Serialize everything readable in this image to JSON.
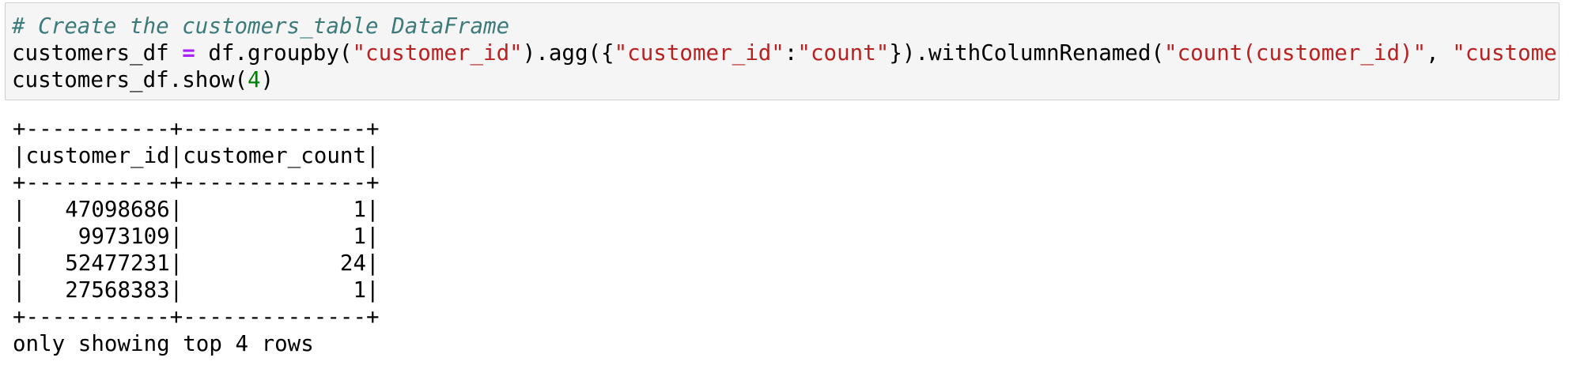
{
  "code_cell": {
    "comment": "# Create the customers_table DataFrame",
    "line2": {
      "var": "customers_df ",
      "op": "=",
      "p1": " df.groupby(",
      "s1": "\"customer_id\"",
      "p2": ").agg({",
      "s2": "\"customer_id\"",
      "p3": ":",
      "s3": "\"count\"",
      "p4": "}).withColumnRenamed(",
      "s4": "\"count(customer_id)\"",
      "p5": ", ",
      "s5": "\"customer_count\")"
    },
    "line3": {
      "p1": "customers_df.show(",
      "num": "4",
      "p2": ")"
    }
  },
  "output": {
    "border_line": "+-----------+--------------+",
    "header_line": "|customer_id|customer_count|",
    "rows": [
      "|   47098686|             1|",
      "|    9973109|             1|",
      "|   52477231|            24|",
      "|   27568383|             1|"
    ],
    "footer_text": "only showing top 4 rows"
  }
}
